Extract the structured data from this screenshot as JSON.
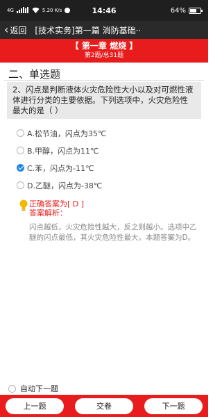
{
  "status_bar": {
    "network": "4G",
    "speed": "5.20 K/s",
    "time": "14:46",
    "battery_percent": "64%",
    "battery_level": 0.64
  },
  "nav": {
    "back_label": "返回",
    "title": "[技术实务]第一篇 消防基础··"
  },
  "chapter": {
    "title": "【 第一章 燃烧 】",
    "progress": "第2题/总31题"
  },
  "section_title": "二、单选题",
  "question": {
    "text": "2、闪点是判断液体火灾危险性大小以及对可燃性液体进行分类的主要依据。下列选项中，火灾危险性最大的是（ ）"
  },
  "options": [
    {
      "label": "A.松节油，闪点为35℃",
      "selected": false
    },
    {
      "label": "B.甲醇，闪点为11℃",
      "selected": false
    },
    {
      "label": "C.苯，闪点为-11℃",
      "selected": true
    },
    {
      "label": "D.乙醚，闪点为-38℃",
      "selected": false
    }
  ],
  "answer": {
    "correct_line": "正确答案为[ D ]",
    "analysis_label": "答案解析：",
    "analysis_text": "闪点越低，火灾危险性越大，反之则越小。选项中乙醚的闪点最低，其火灾危险性最大。本题答案为D。"
  },
  "auto_next_label": "自动下一题",
  "buttons": {
    "prev": "上一题",
    "submit": "交卷",
    "next": "下一题"
  },
  "colors": {
    "accent_red": "#e81c1c",
    "selected_blue": "#1e88e5",
    "bulb_yellow": "#f5b800"
  }
}
